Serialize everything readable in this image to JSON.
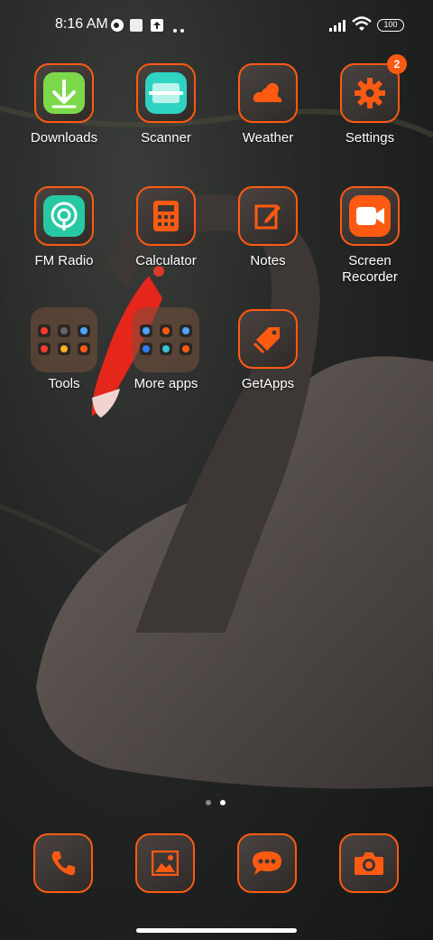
{
  "status_bar": {
    "time": "8:16 AM",
    "battery": "100",
    "icons": [
      "account-circle-icon",
      "square-notification-icon",
      "upload-box-icon",
      "more-dots-icon",
      "signal-icon",
      "wifi-icon",
      "battery-icon"
    ]
  },
  "apps": [
    {
      "label": "Downloads",
      "icon": "download-arrow-icon"
    },
    {
      "label": "Scanner",
      "icon": "scanner-icon"
    },
    {
      "label": "Weather",
      "icon": "cloud-sun-icon"
    },
    {
      "label": "Settings",
      "icon": "gear-icon",
      "badge": "2"
    },
    {
      "label": "FM Radio",
      "icon": "radio-icon"
    },
    {
      "label": "Calculator",
      "icon": "calculator-icon"
    },
    {
      "label": "Notes",
      "icon": "edit-note-icon"
    },
    {
      "label": "Screen Recorder",
      "icon": "video-record-icon"
    },
    {
      "label": "Tools",
      "icon": "folder-icon"
    },
    {
      "label": "More apps",
      "icon": "folder-icon"
    },
    {
      "label": "GetApps",
      "icon": "price-tag-icon"
    }
  ],
  "dock": [
    {
      "name": "phone",
      "icon": "phone-icon"
    },
    {
      "name": "gallery",
      "icon": "gallery-icon"
    },
    {
      "name": "messaging",
      "icon": "chat-bubble-icon"
    },
    {
      "name": "camera",
      "icon": "camera-icon"
    }
  ],
  "page_indicator": {
    "pages": 2,
    "current": 2
  },
  "colors": {
    "accent": "#ff5a12",
    "badge": "#ff5a12"
  }
}
